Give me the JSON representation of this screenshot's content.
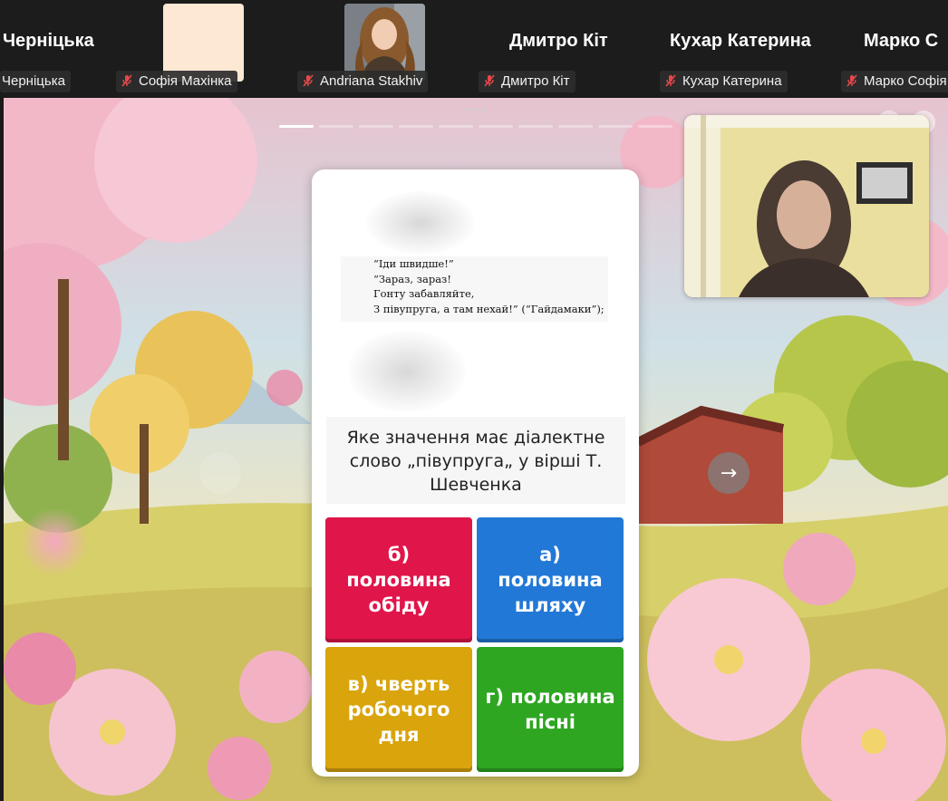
{
  "participants": [
    {
      "display_name": "Черніцька",
      "label": "Черніцька",
      "muted": false
    },
    {
      "display_name": "",
      "label": "Софія Махінка",
      "muted": true
    },
    {
      "display_name": "",
      "label": "Andriana Stakhiv",
      "muted": true
    },
    {
      "display_name": "Дмитро Кіт",
      "label": "Дмитро Кіт",
      "muted": true
    },
    {
      "display_name": "Кухар Катерина",
      "label": "Кухар Катерина",
      "muted": true
    },
    {
      "display_name": "Марко С",
      "label": "Марко Софія",
      "muted": true
    }
  ],
  "quiz": {
    "progress_total": 10,
    "progress_current": 1,
    "poem_lines": [
      "“Іди швидше!”",
      "“Зараз, зараз!",
      "Гонту забавляйте,",
      "З півупруга, а там нехай!” (“Гайдамаки”);"
    ],
    "question": "Яке значення має діалектне слово  „півупруга„ у вірші Т. Шевченка",
    "answers": [
      {
        "text": "б) половина обіду",
        "color": "#e0154a"
      },
      {
        "text": "а) половина шляху",
        "color": "#2278d6"
      },
      {
        "text": "в) чверть робочого дня",
        "color": "#d9a40c"
      },
      {
        "text": "г) половина пісні",
        "color": "#2ea621"
      }
    ],
    "next_symbol": "→",
    "drag_symbol": "•••"
  },
  "icons": {
    "muted_mic": "mic-off-icon",
    "next": "arrow-right-icon"
  }
}
